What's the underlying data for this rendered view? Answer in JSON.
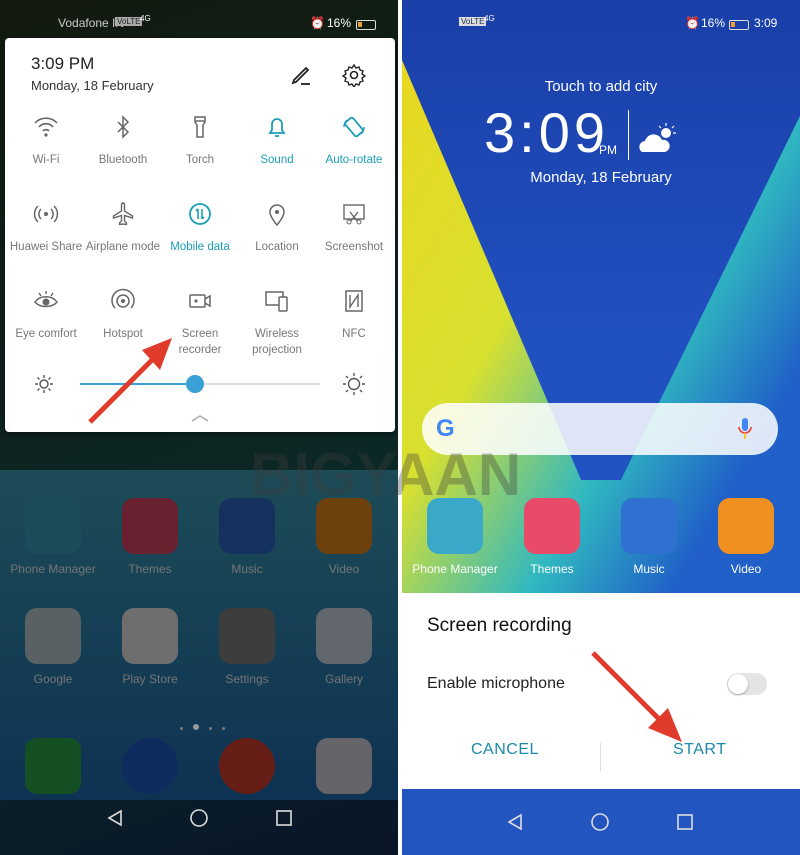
{
  "left": {
    "status": {
      "carrier": "Vodafone IN",
      "volte": "VoLTE",
      "network": "4G",
      "battery": "16%"
    },
    "quick_settings": {
      "time": "3:09 PM",
      "date": "Monday, 18 February",
      "edit_icon": "pencil-icon",
      "settings_icon": "gear-icon",
      "tiles": [
        {
          "label": "Wi-Fi",
          "icon": "wifi",
          "active": false
        },
        {
          "label": "Bluetooth",
          "icon": "bluetooth",
          "active": false
        },
        {
          "label": "Torch",
          "icon": "torch",
          "active": false
        },
        {
          "label": "Sound",
          "icon": "bell",
          "active": true
        },
        {
          "label": "Auto-rotate",
          "icon": "rotate",
          "active": true
        },
        {
          "label": "Huawei Share",
          "icon": "share",
          "active": false
        },
        {
          "label": "Airplane mode",
          "icon": "airplane",
          "active": false
        },
        {
          "label": "Mobile data",
          "icon": "data",
          "active": true
        },
        {
          "label": "Location",
          "icon": "location",
          "active": false
        },
        {
          "label": "Screenshot",
          "icon": "screenshot",
          "active": false
        },
        {
          "label": "Eye comfort",
          "icon": "eye",
          "active": false
        },
        {
          "label": "Hotspot",
          "icon": "hotspot",
          "active": false
        },
        {
          "label": "Screen recorder",
          "icon": "recorder",
          "active": false
        },
        {
          "label": "Wireless projection",
          "icon": "projection",
          "active": false
        },
        {
          "label": "NFC",
          "icon": "nfc",
          "active": false
        }
      ],
      "brightness_percent": 48
    },
    "apps": [
      {
        "label": "Phone Manager",
        "color": "#3aa8c8"
      },
      {
        "label": "Themes",
        "color": "#e84a6a"
      },
      {
        "label": "Music",
        "color": "#3070d0"
      },
      {
        "label": "Video",
        "color": "#f09020"
      },
      {
        "label": "Google",
        "color": "#c8d8e0"
      },
      {
        "label": "Play Store",
        "color": "#f4f4f4"
      },
      {
        "label": "Settings",
        "color": "#888888"
      },
      {
        "label": "Gallery",
        "color": "#d8e4f0"
      }
    ],
    "dock": [
      {
        "name": "phone",
        "color": "#30b050"
      },
      {
        "name": "messages",
        "color": "#2060d0"
      },
      {
        "name": "chrome",
        "color": "#e04030"
      },
      {
        "name": "camera",
        "color": "#e0e0e8"
      }
    ]
  },
  "right": {
    "status": {
      "volte": "VoLTE",
      "network": "4G",
      "battery": "16%",
      "time": "3:09"
    },
    "weather": {
      "city_prompt": "Touch to add city",
      "time": "3:09",
      "ampm": "PM",
      "date": "Monday, 18 February",
      "icon": "partly-cloudy-icon"
    },
    "apps": [
      {
        "label": "Phone Manager",
        "color": "#3aa8c8"
      },
      {
        "label": "Themes",
        "color": "#e84a6a"
      },
      {
        "label": "Music",
        "color": "#3070d0"
      },
      {
        "label": "Video",
        "color": "#f09020"
      }
    ],
    "dialog": {
      "title": "Screen recording",
      "microphone_label": "Enable microphone",
      "microphone_enabled": false,
      "cancel": "CANCEL",
      "start": "START"
    }
  },
  "watermark": "BIGYAAN",
  "colors": {
    "accent": "#1a9fb8",
    "arrow": "#e03a2a"
  }
}
